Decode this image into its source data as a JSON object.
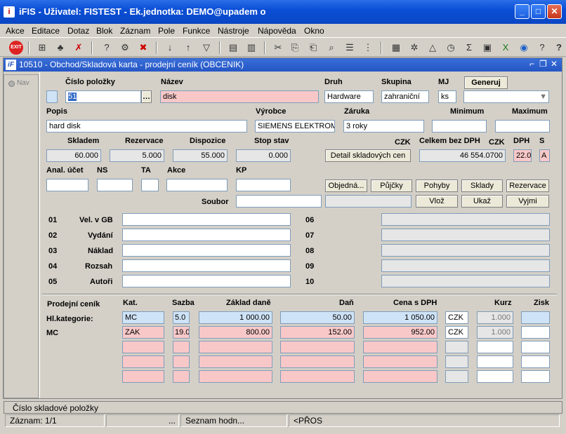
{
  "window": {
    "title": "iFIS - Uživatel: FISTEST - Ek.jednotka: DEMO@upadem o"
  },
  "menu": [
    "Akce",
    "Editace",
    "Dotaz",
    "Blok",
    "Záznam",
    "Pole",
    "Funkce",
    "Nástroje",
    "Nápověda",
    "Okno"
  ],
  "inner": {
    "title": "10510 - Obchod/Skladová karta - prodejní ceník (OBCENIK)"
  },
  "nav": {
    "label": "Nav"
  },
  "labels": {
    "cislo": "Číslo položky",
    "nazev": "Název",
    "druh": "Druh",
    "skupina": "Skupina",
    "mj": "MJ",
    "popis": "Popis",
    "vyrobce": "Výrobce",
    "zaruka": "Záruka",
    "minimum": "Minimum",
    "maximum": "Maximum",
    "skladem": "Skladem",
    "rezervace": "Rezervace",
    "dispozice": "Dispozice",
    "stop": "Stop stav",
    "czk1": "CZK",
    "celkem": "Celkem bez DPH",
    "czk2": "CZK",
    "dph": "DPH",
    "s": "S",
    "anal": "Anal. účet",
    "ns": "NS",
    "ta": "TA",
    "akce": "Akce",
    "kp": "KP",
    "soubor": "Soubor",
    "prodejni": "Prodejní ceník",
    "hlkat": "Hl.kategorie:",
    "mc": "MC",
    "kat": "Kat.",
    "sazba": "Sazba",
    "zaklad": "Základ daně",
    "dan": "Daň",
    "cenasdph": "Cena s DPH",
    "kurz": "Kurz",
    "zisk": "Zisk"
  },
  "values": {
    "cislo": "51",
    "nazev": "disk",
    "druh": "Hardware",
    "skupina": "zahraniční",
    "mj": "ks",
    "popis": "hard disk",
    "vyrobce": "SIEMENS ELEKTROMOT",
    "zaruka": "3 roky",
    "skladem": "60.000",
    "rezervace": "5.000",
    "dispozice": "55.000",
    "stop": "0.000",
    "celkem": "46 554.0700",
    "dph": "22.0",
    "s": "A"
  },
  "buttons": {
    "generuj": "Generuj",
    "detail": "Detail skladových cen",
    "objedna": "Objedná...",
    "pujcky": "Půjčky",
    "pohyby": "Pohyby",
    "sklady": "Sklady",
    "rezervace": "Rezervace",
    "vloz": "Vlož",
    "ukaz": "Ukaž",
    "vyjmi": "Vyjmi"
  },
  "params": [
    {
      "num": "01",
      "label": "Vel. v GB"
    },
    {
      "num": "02",
      "label": "Vydání"
    },
    {
      "num": "03",
      "label": "Náklad"
    },
    {
      "num": "04",
      "label": "Rozsah"
    },
    {
      "num": "05",
      "label": "Autoři"
    }
  ],
  "params_right": [
    "06",
    "07",
    "08",
    "09",
    "10"
  ],
  "price_rows": [
    {
      "kat": "MC",
      "sazba": "5.0",
      "zaklad": "1 000.00",
      "dan": "50.00",
      "cena": "1 050.00",
      "mena": "CZK",
      "kurz": "1.000"
    },
    {
      "kat": "ZAK",
      "sazba": "19.0",
      "zaklad": "800.00",
      "dan": "152.00",
      "cena": "952.00",
      "mena": "CZK",
      "kurz": "1.000"
    }
  ],
  "status": {
    "hint": "Číslo skladové položky",
    "record": "Záznam: 1/1",
    "dots": "...",
    "list": "Seznam hodn...",
    "mode": "<PŘOS"
  }
}
